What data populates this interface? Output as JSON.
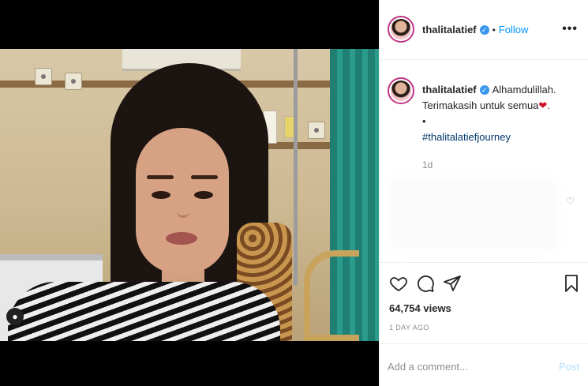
{
  "post": {
    "username": "thalitalatief",
    "follow_label": "Follow",
    "separator": "•",
    "more_label": "•••",
    "verified_mark": "✓"
  },
  "caption": {
    "username": "thalitalatief",
    "line1": "Alhamdulillah.",
    "line2": "Terimakasih untuk semua",
    "heart": "❤",
    "line2_end": ".",
    "line3": "•",
    "hashtag": "#thalitalatiefjourney",
    "time": "1d"
  },
  "stats": {
    "views": "64,754 views",
    "posted": "1 DAY AGO"
  },
  "comment_box": {
    "placeholder": "Add a comment...",
    "post_label": "Post"
  },
  "icons": {
    "like": "heart-icon",
    "comment": "comment-icon",
    "share": "share-icon",
    "save": "bookmark-icon",
    "more": "more-icon",
    "verified": "verified-badge-icon"
  },
  "colors": {
    "link": "#0095f6",
    "verified": "#3897f0",
    "muted": "#8e8e8e",
    "post_disabled": "#b2dffc",
    "heart": "#d0112b"
  }
}
